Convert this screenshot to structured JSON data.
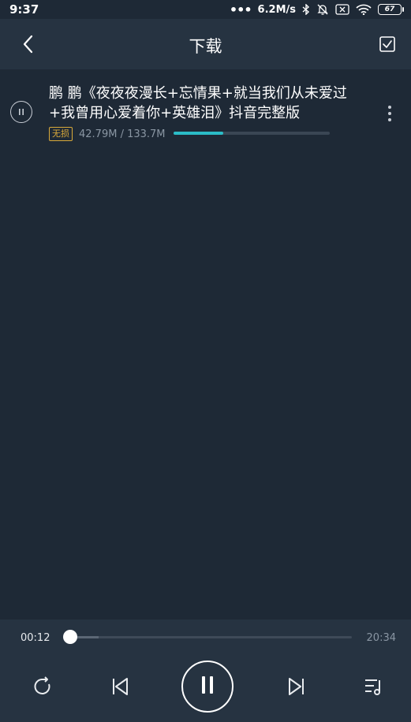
{
  "status_bar": {
    "time": "9:37",
    "network_speed": "6.2M/s",
    "battery": "67",
    "icons": [
      "more-dots-icon",
      "bluetooth-icon",
      "bell-off-icon",
      "no-sim-icon",
      "wifi-icon",
      "battery-icon"
    ]
  },
  "header": {
    "title": "下载",
    "icons": [
      "back-arrow-icon",
      "checkbox-select-icon"
    ]
  },
  "download_item": {
    "title": "鹏 鹏《夜夜夜漫长+忘情果+就当我们从未爱过+我曾用心爱着你+英雄泪》抖音完整版",
    "badge": "无损",
    "size_text": "42.79M / 133.7M",
    "progress": 0.32,
    "icons": [
      "pause-icon",
      "more-vertical-icon"
    ]
  },
  "player": {
    "current_time": "00:12",
    "duration": "20:34",
    "position": 0.01,
    "buffered": 0.11,
    "icons": [
      "repeat-icon",
      "previous-icon",
      "pause-icon",
      "next-icon",
      "playlist-icon"
    ]
  },
  "colors": {
    "background": "#1e2936",
    "bar": "#263341",
    "accent": "#2bbcc7",
    "badge": "#d9a93a"
  }
}
